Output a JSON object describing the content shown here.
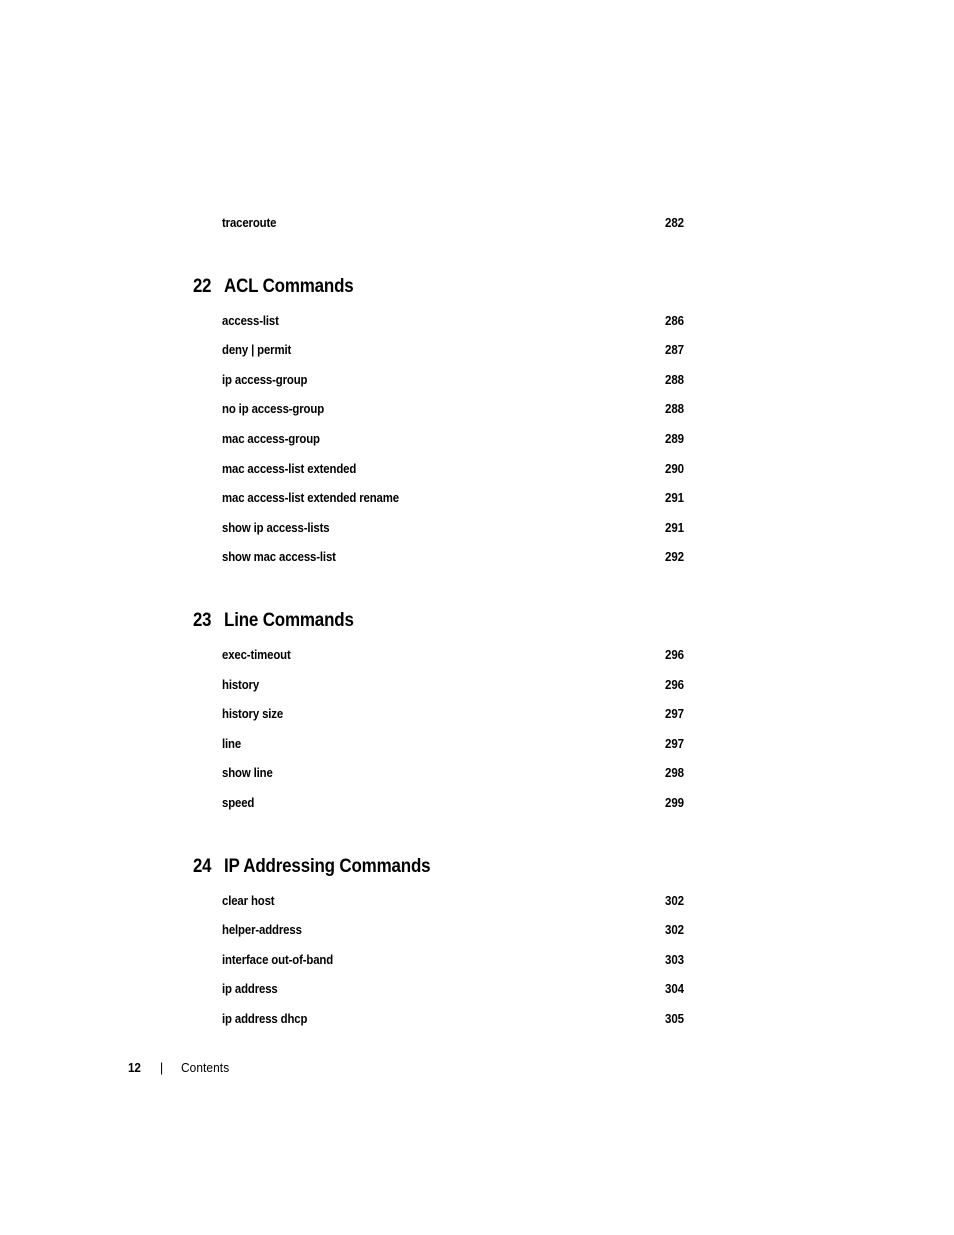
{
  "document": {
    "footer": {
      "page_number": "12",
      "separator": "|",
      "section_label": "Contents"
    }
  },
  "toc": {
    "leading_entries": [
      {
        "label": "traceroute",
        "page": "282"
      }
    ],
    "chapters": [
      {
        "number": "22",
        "title": "ACL Commands",
        "entries": [
          {
            "label": "access-list",
            "page": "286"
          },
          {
            "label": "deny | permit",
            "page": "287"
          },
          {
            "label": "ip access-group",
            "page": "288"
          },
          {
            "label": "no ip access-group",
            "page": "288"
          },
          {
            "label": "mac access-group",
            "page": "289"
          },
          {
            "label": "mac access-list extended",
            "page": "290"
          },
          {
            "label": "mac access-list extended rename",
            "page": "291"
          },
          {
            "label": "show ip access-lists",
            "page": "291"
          },
          {
            "label": "show mac access-list",
            "page": "292"
          }
        ]
      },
      {
        "number": "23",
        "title": "Line Commands",
        "entries": [
          {
            "label": "exec-timeout",
            "page": "296"
          },
          {
            "label": "history",
            "page": "296"
          },
          {
            "label": "history size",
            "page": "297"
          },
          {
            "label": "line",
            "page": "297"
          },
          {
            "label": "show line",
            "page": "298"
          },
          {
            "label": "speed",
            "page": "299"
          }
        ]
      },
      {
        "number": "24",
        "title": "IP Addressing Commands",
        "entries": [
          {
            "label": "clear host",
            "page": "302"
          },
          {
            "label": "helper-address",
            "page": "302"
          },
          {
            "label": "interface out-of-band",
            "page": "303"
          },
          {
            "label": "ip address",
            "page": "304"
          },
          {
            "label": "ip address dhcp",
            "page": "305"
          }
        ]
      }
    ]
  }
}
